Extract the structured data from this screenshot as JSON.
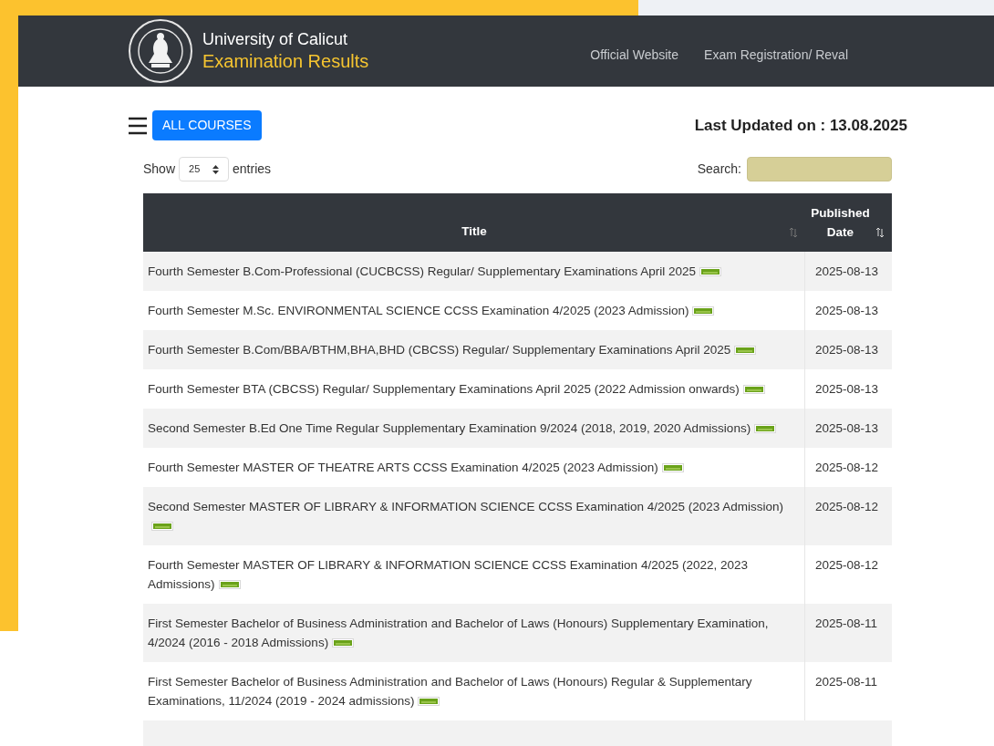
{
  "header": {
    "university": "University of Calicut",
    "subtitle": "Examination Results",
    "nav": [
      "Official Website",
      "Exam Registration/ Reval"
    ]
  },
  "toolbar": {
    "button": "ALL COURSES",
    "last_updated": "Last Updated on : 13.08.2025"
  },
  "length": {
    "before": "Show",
    "value": "25",
    "after": "entries"
  },
  "search": {
    "label": "Search:"
  },
  "table": {
    "columns": [
      "Title",
      "Published Date"
    ],
    "rows": [
      {
        "title": "Fourth Semester B.Com-Professional (CUCBCSS) Regular/ Supplementary Examinations April 2025",
        "is_new": true,
        "date": "2025-08-13"
      },
      {
        "title": "Fourth Semester M.Sc. ENVIRONMENTAL SCIENCE CCSS Examination 4/2025 (2023 Admission)",
        "is_new": true,
        "date": "2025-08-13"
      },
      {
        "title": "Fourth Semester B.Com/BBA/BTHM,BHA,BHD (CBCSS) Regular/ Supplementary Examinations April 2025",
        "is_new": true,
        "date": "2025-08-13"
      },
      {
        "title": "Fourth Semester BTA (CBCSS) Regular/ Supplementary Examinations April 2025 (2022 Admission onwards)",
        "is_new": true,
        "date": "2025-08-13"
      },
      {
        "title": "Second Semester B.Ed One Time Regular Supplementary Examination 9/2024 (2018, 2019, 2020 Admissions)",
        "is_new": true,
        "date": "2025-08-13"
      },
      {
        "title": "Fourth Semester MASTER OF THEATRE ARTS CCSS Examination 4/2025 (2023 Admission)",
        "is_new": true,
        "date": "2025-08-12"
      },
      {
        "title": "Second Semester MASTER OF LIBRARY & INFORMATION SCIENCE CCSS Examination 4/2025 (2023 Admission)",
        "is_new": true,
        "date": "2025-08-12"
      },
      {
        "title": "Fourth Semester MASTER OF LIBRARY & INFORMATION SCIENCE CCSS Examination 4/2025 (2022, 2023 Admissions)",
        "is_new": true,
        "date": "2025-08-12"
      },
      {
        "title": "First Semester Bachelor of Business Administration and Bachelor of Laws (Honours) Supplementary Examination, 4/2024 (2016 - 2018 Admissions)",
        "is_new": true,
        "date": "2025-08-11"
      },
      {
        "title": "First Semester Bachelor of Business Administration and Bachelor of Laws (Honours) Regular & Supplementary Examinations, 11/2024 (2019 - 2024 admissions)",
        "is_new": true,
        "date": "2025-08-11"
      }
    ]
  }
}
